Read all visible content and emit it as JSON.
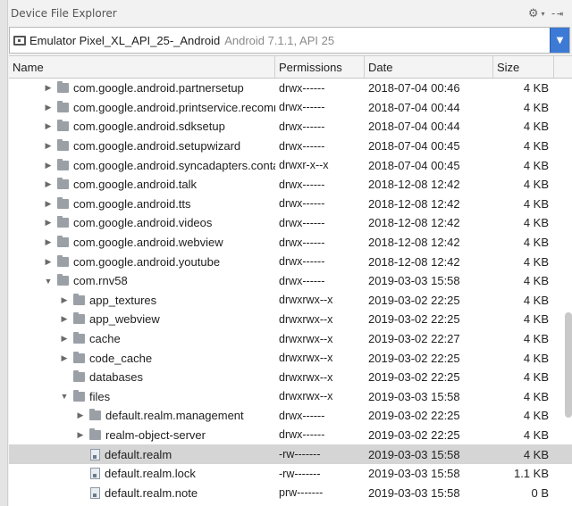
{
  "window": {
    "title": "Device File Explorer",
    "gear_icon": "gear-icon",
    "hide_icon": "hide-panel-icon"
  },
  "device": {
    "name": "Emulator Pixel_XL_API_25-_Android",
    "version": "Android 7.1.1, API 25"
  },
  "columns": {
    "name": "Name",
    "permissions": "Permissions",
    "date": "Date",
    "size": "Size"
  },
  "rows": [
    {
      "depth": 0,
      "type": "folder",
      "expanded": false,
      "name": "com.google.android.partnersetup",
      "permissions": "drwx------",
      "date": "2018-07-04 00:46",
      "size": "4 KB"
    },
    {
      "depth": 0,
      "type": "folder",
      "expanded": false,
      "name": "com.google.android.printservice.recommendation",
      "permissions": "drwx------",
      "date": "2018-07-04 00:44",
      "size": "4 KB"
    },
    {
      "depth": 0,
      "type": "folder",
      "expanded": false,
      "name": "com.google.android.sdksetup",
      "permissions": "drwx------",
      "date": "2018-07-04 00:44",
      "size": "4 KB"
    },
    {
      "depth": 0,
      "type": "folder",
      "expanded": false,
      "name": "com.google.android.setupwizard",
      "permissions": "drwx------",
      "date": "2018-07-04 00:45",
      "size": "4 KB"
    },
    {
      "depth": 0,
      "type": "folder",
      "expanded": false,
      "name": "com.google.android.syncadapters.contacts",
      "permissions": "drwxr-x--x",
      "date": "2018-07-04 00:45",
      "size": "4 KB"
    },
    {
      "depth": 0,
      "type": "folder",
      "expanded": false,
      "name": "com.google.android.talk",
      "permissions": "drwx------",
      "date": "2018-12-08 12:42",
      "size": "4 KB"
    },
    {
      "depth": 0,
      "type": "folder",
      "expanded": false,
      "name": "com.google.android.tts",
      "permissions": "drwx------",
      "date": "2018-12-08 12:42",
      "size": "4 KB"
    },
    {
      "depth": 0,
      "type": "folder",
      "expanded": false,
      "name": "com.google.android.videos",
      "permissions": "drwx------",
      "date": "2018-12-08 12:42",
      "size": "4 KB"
    },
    {
      "depth": 0,
      "type": "folder",
      "expanded": false,
      "name": "com.google.android.webview",
      "permissions": "drwx------",
      "date": "2018-12-08 12:42",
      "size": "4 KB"
    },
    {
      "depth": 0,
      "type": "folder",
      "expanded": false,
      "name": "com.google.android.youtube",
      "permissions": "drwx------",
      "date": "2018-12-08 12:42",
      "size": "4 KB"
    },
    {
      "depth": 0,
      "type": "folder",
      "expanded": true,
      "name": "com.rnv58",
      "permissions": "drwx------",
      "date": "2019-03-03 15:58",
      "size": "4 KB"
    },
    {
      "depth": 1,
      "type": "folder",
      "expanded": false,
      "name": "app_textures",
      "permissions": "drwxrwx--x",
      "date": "2019-03-02 22:25",
      "size": "4 KB"
    },
    {
      "depth": 1,
      "type": "folder",
      "expanded": false,
      "name": "app_webview",
      "permissions": "drwxrwx--x",
      "date": "2019-03-02 22:25",
      "size": "4 KB"
    },
    {
      "depth": 1,
      "type": "folder",
      "expanded": false,
      "name": "cache",
      "permissions": "drwxrwx--x",
      "date": "2019-03-02 22:27",
      "size": "4 KB"
    },
    {
      "depth": 1,
      "type": "folder",
      "expanded": false,
      "name": "code_cache",
      "permissions": "drwxrwx--x",
      "date": "2019-03-02 22:25",
      "size": "4 KB"
    },
    {
      "depth": 1,
      "type": "folder",
      "expanded": null,
      "name": "databases",
      "permissions": "drwxrwx--x",
      "date": "2019-03-02 22:25",
      "size": "4 KB"
    },
    {
      "depth": 1,
      "type": "folder",
      "expanded": true,
      "name": "files",
      "permissions": "drwxrwx--x",
      "date": "2019-03-03 15:58",
      "size": "4 KB"
    },
    {
      "depth": 2,
      "type": "folder",
      "expanded": false,
      "name": "default.realm.management",
      "permissions": "drwx------",
      "date": "2019-03-02 22:25",
      "size": "4 KB"
    },
    {
      "depth": 2,
      "type": "folder",
      "expanded": false,
      "name": "realm-object-server",
      "permissions": "drwx------",
      "date": "2019-03-02 22:25",
      "size": "4 KB"
    },
    {
      "depth": 2,
      "type": "file",
      "expanded": null,
      "name": "default.realm",
      "permissions": "-rw-------",
      "date": "2019-03-03 15:58",
      "size": "4 KB",
      "selected": true
    },
    {
      "depth": 2,
      "type": "file",
      "expanded": null,
      "name": "default.realm.lock",
      "permissions": "-rw-------",
      "date": "2019-03-03 15:58",
      "size": "1.1 KB"
    },
    {
      "depth": 2,
      "type": "file",
      "expanded": null,
      "name": "default.realm.note",
      "permissions": "prw-------",
      "date": "2019-03-03 15:58",
      "size": "0 B"
    }
  ]
}
